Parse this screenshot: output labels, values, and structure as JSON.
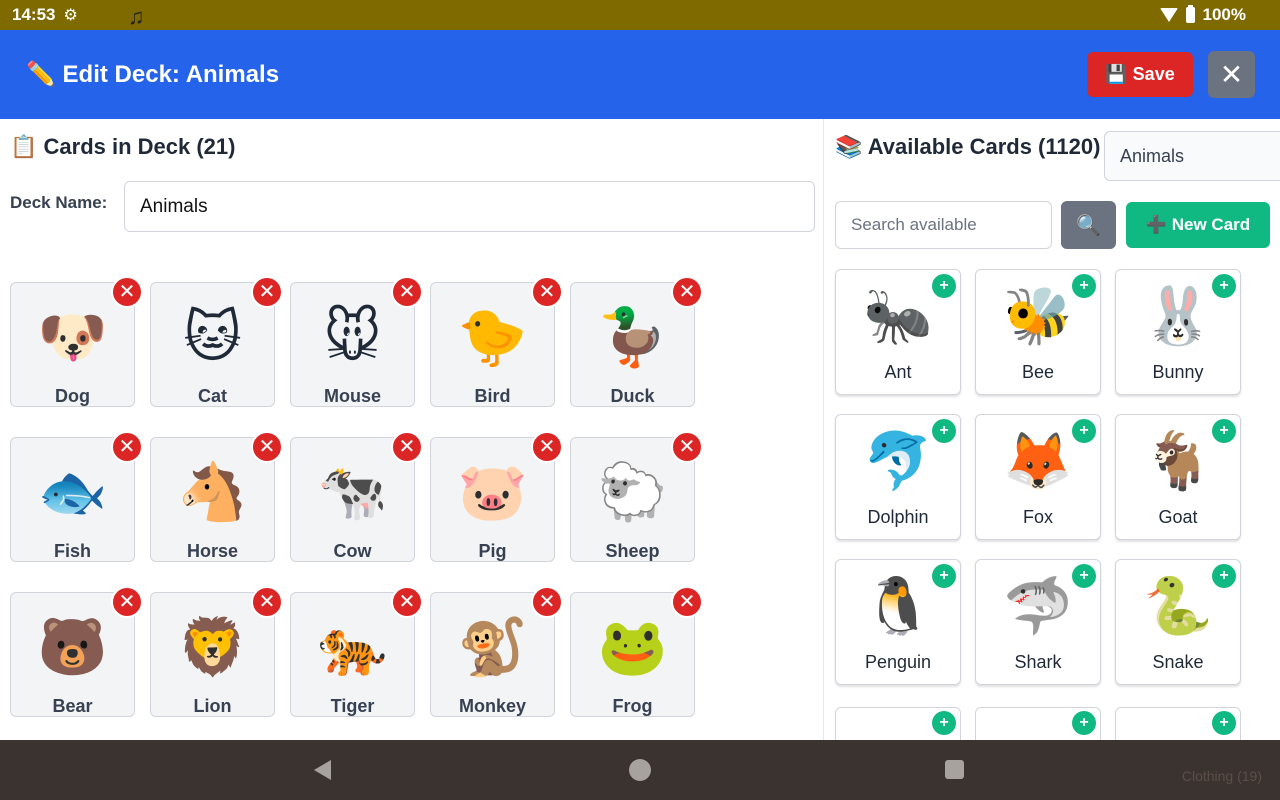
{
  "status_bar": {
    "time": "14:53",
    "battery": "100%"
  },
  "header": {
    "title": "✏️ Edit Deck: Animals",
    "save_label": "💾 Save",
    "close_symbol": "✕"
  },
  "left": {
    "title": "📋 Cards in Deck (21)",
    "deck_name_label": "Deck Name:",
    "deck_name_value": "Animals",
    "remove_symbol": "✕",
    "cards": [
      {
        "emoji": "🐶",
        "label": "Dog"
      },
      {
        "emoji": "🐱",
        "label": "Cat"
      },
      {
        "emoji": "🐭",
        "label": "Mouse"
      },
      {
        "emoji": "🐤",
        "label": "Bird"
      },
      {
        "emoji": "🦆",
        "label": "Duck"
      },
      {
        "emoji": "🐟",
        "label": "Fish"
      },
      {
        "emoji": "🐴",
        "label": "Horse"
      },
      {
        "emoji": "🐄",
        "label": "Cow"
      },
      {
        "emoji": "🐷",
        "label": "Pig"
      },
      {
        "emoji": "🐑",
        "label": "Sheep"
      },
      {
        "emoji": "🐻",
        "label": "Bear"
      },
      {
        "emoji": "🦁",
        "label": "Lion"
      },
      {
        "emoji": "🐅",
        "label": "Tiger"
      },
      {
        "emoji": "🐒",
        "label": "Monkey"
      },
      {
        "emoji": "🐸",
        "label": "Frog"
      }
    ]
  },
  "right": {
    "title": "📚 Available Cards (1120)",
    "category_value": "Animals",
    "search_placeholder": "Search available",
    "search_icon": "🔍",
    "new_card_label": "➕ New Card",
    "add_symbol": "+",
    "cards": [
      {
        "emoji": "🐜",
        "label": "Ant"
      },
      {
        "emoji": "🐝",
        "label": "Bee"
      },
      {
        "emoji": "🐰",
        "label": "Bunny"
      },
      {
        "emoji": "🐬",
        "label": "Dolphin"
      },
      {
        "emoji": "🦊",
        "label": "Fox"
      },
      {
        "emoji": "🐐",
        "label": "Goat"
      },
      {
        "emoji": "🐧",
        "label": "Penguin"
      },
      {
        "emoji": "🦈",
        "label": "Shark"
      },
      {
        "emoji": "🐍",
        "label": "Snake"
      }
    ]
  },
  "nav_bar": {
    "ghost_text": "Clothing (19)"
  },
  "colors": {
    "header": "#2563eb",
    "save": "#dc2626",
    "add": "#10b981",
    "status_bar": "#7f6a00"
  }
}
